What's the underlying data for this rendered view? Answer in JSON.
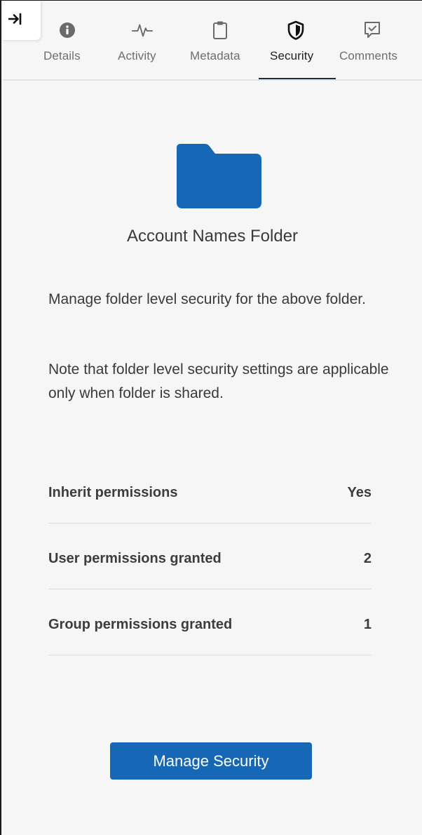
{
  "tabs": [
    {
      "label": "Details",
      "icon": "info-icon"
    },
    {
      "label": "Activity",
      "icon": "activity-icon"
    },
    {
      "label": "Metadata",
      "icon": "clipboard-icon"
    },
    {
      "label": "Security",
      "icon": "shield-icon",
      "active": true
    },
    {
      "label": "Comments",
      "icon": "comment-check-icon"
    }
  ],
  "folder": {
    "name": "Account Names Folder",
    "icon": "folder-icon",
    "color": "#1667b5"
  },
  "description": {
    "line1": "Manage folder level security for the above folder.",
    "line2": "Note that folder level security settings are applicable only when folder is shared."
  },
  "permissions": [
    {
      "label": "Inherit permissions",
      "value": "Yes"
    },
    {
      "label": "User permissions granted",
      "value": "2"
    },
    {
      "label": "Group permissions granted",
      "value": "1"
    }
  ],
  "actions": {
    "manage_label": "Manage Security"
  },
  "colors": {
    "accent": "#1667b5",
    "active_tab_underline": "#1f2a44"
  }
}
